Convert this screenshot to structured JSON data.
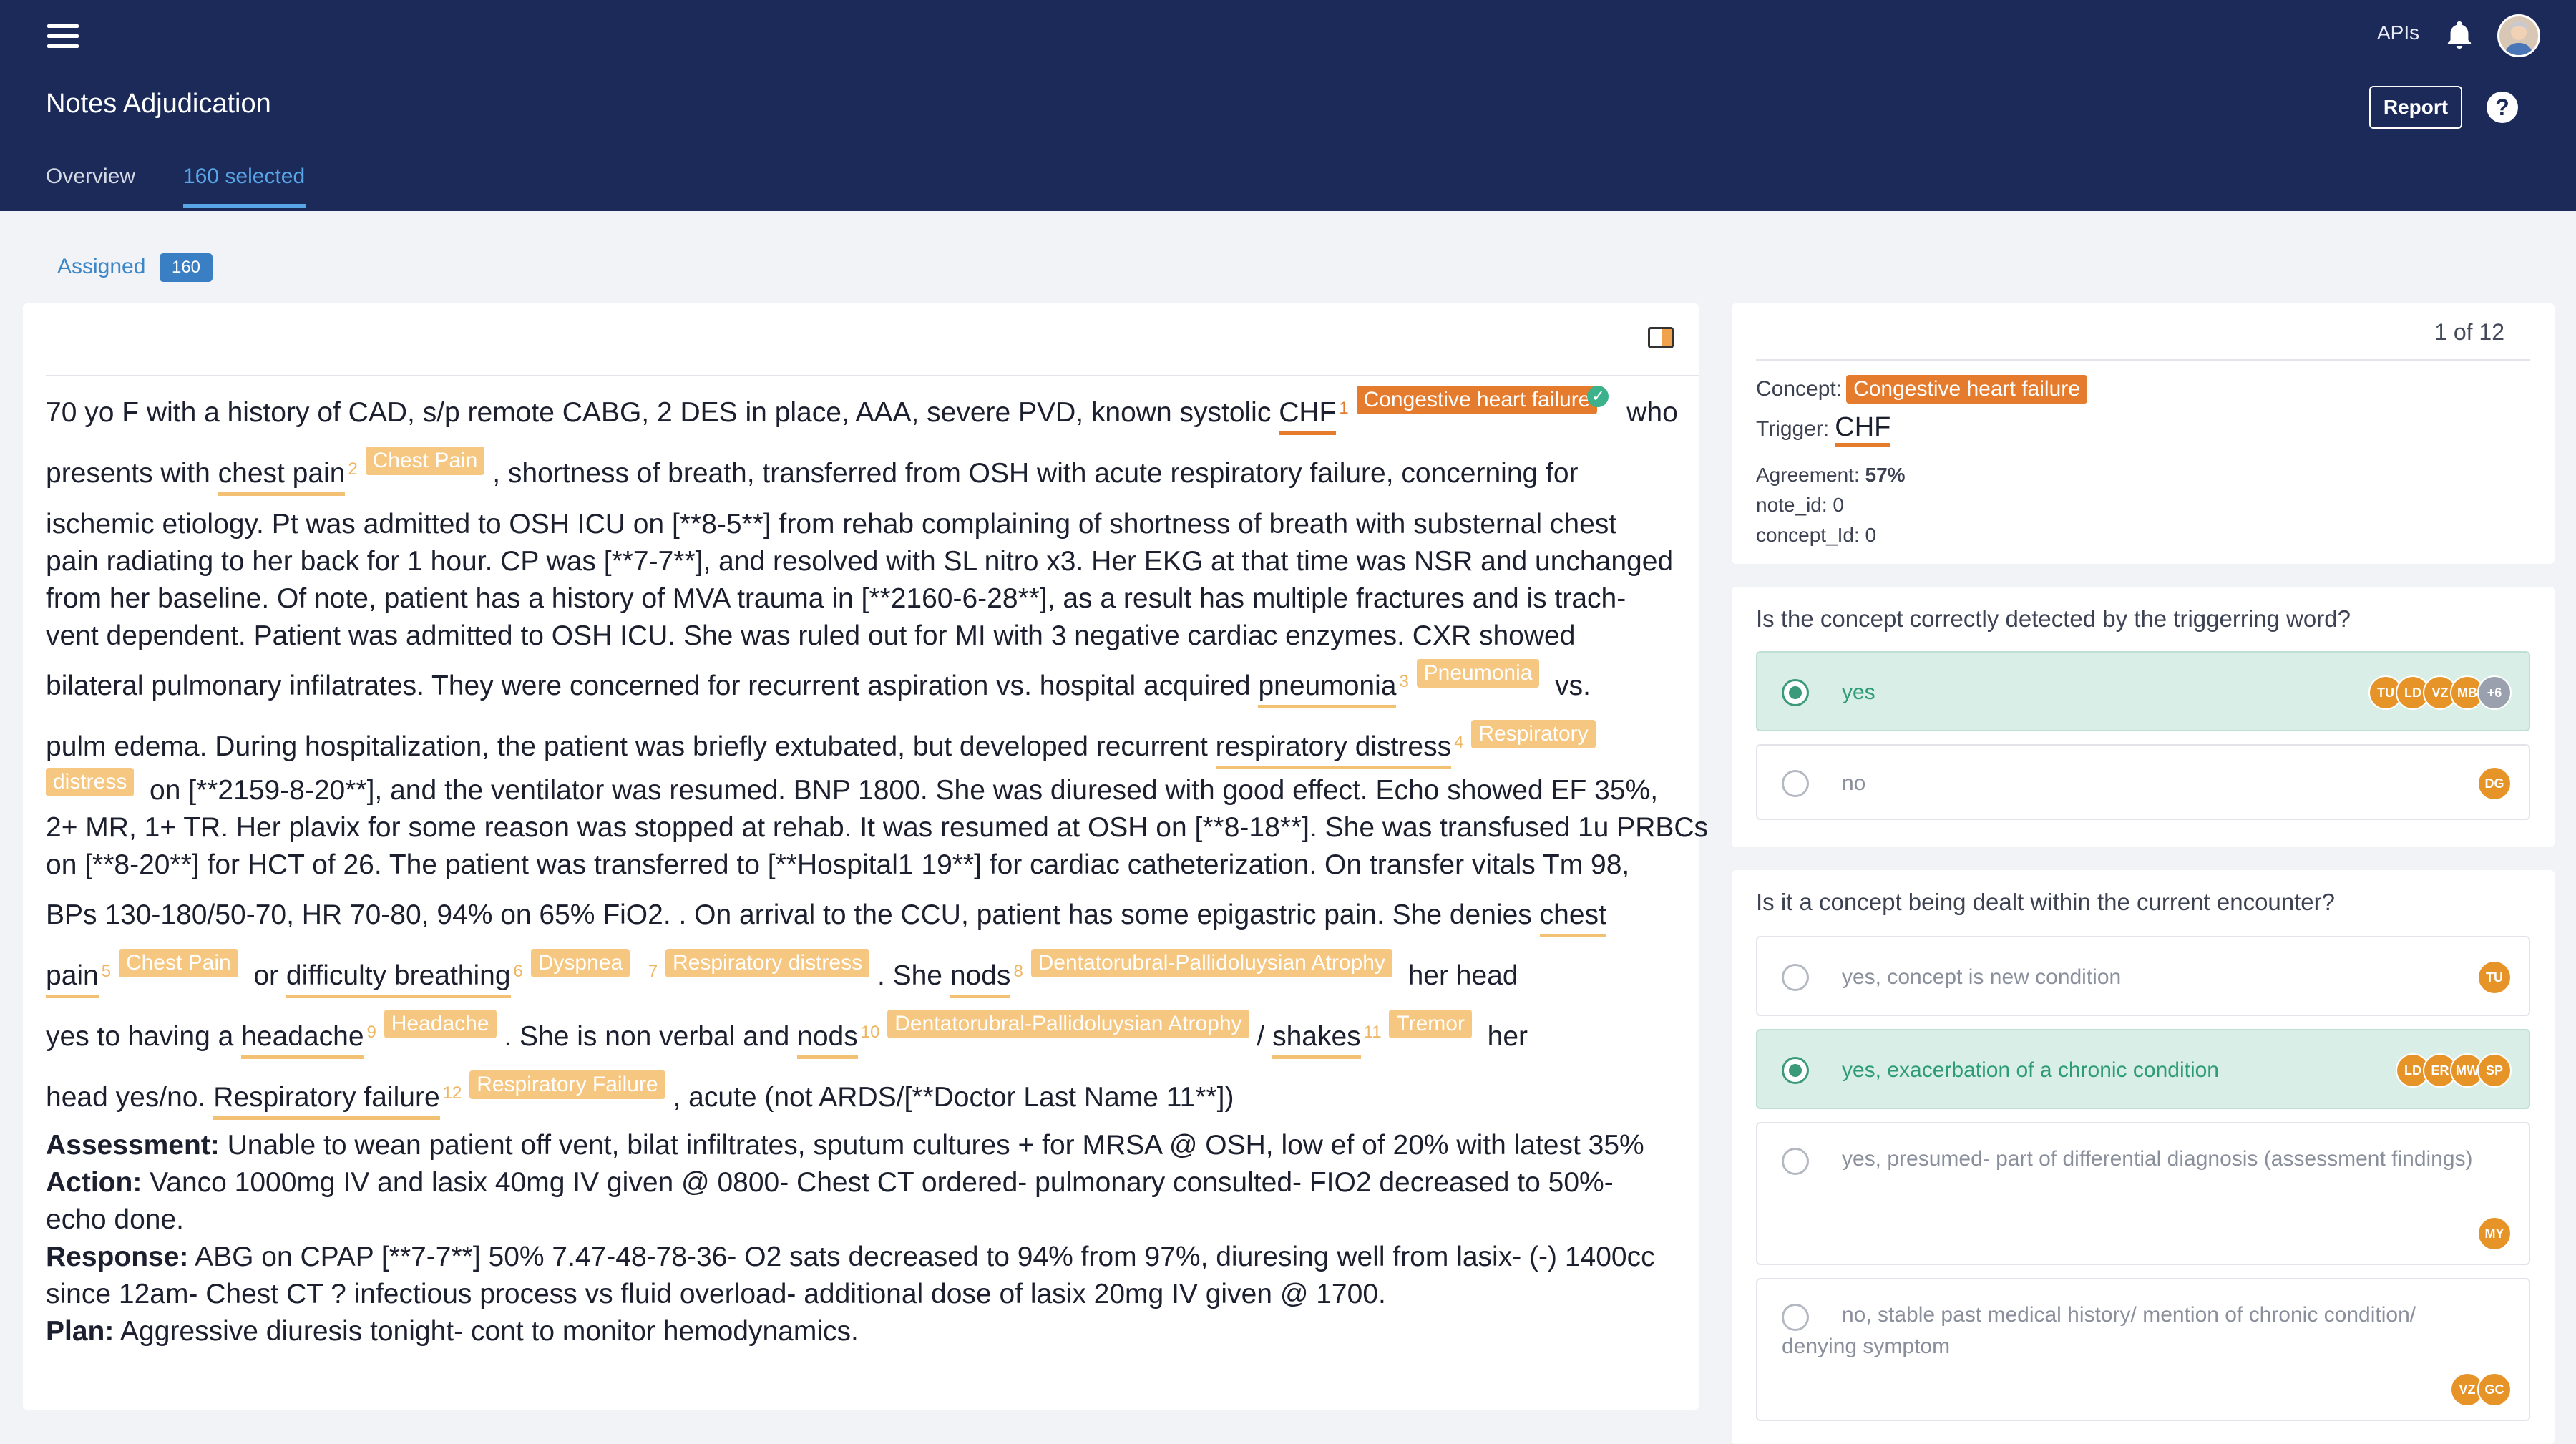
{
  "header": {
    "apis_label": "APIs",
    "title": "Notes Adjudication",
    "report_label": "Report",
    "help_label": "?",
    "tabs": [
      {
        "label": "Overview"
      },
      {
        "label": "160 selected"
      }
    ]
  },
  "assigned": {
    "label": "Assigned",
    "count": "160"
  },
  "note": {
    "p1a": "70 yo F with a history of CAD, s/p remote CABG, 2 DES in place, AAA, severe PVD, known systolic",
    "m1": "CHF",
    "m1_idx": "1",
    "m1_tag": "Congestive heart failure",
    "m1_after": "who",
    "p2a": "presents with",
    "m2": "chest pain",
    "m2_idx": "2",
    "m2_tag": "Chest Pain",
    "p2b": ", shortness of breath, transferred from OSH with acute respiratory failure, concerning for",
    "p3": "ischemic etiology. Pt was admitted to OSH ICU on [**8-5**] from rehab complaining of shortness of breath with substernal chest",
    "p4": "pain radiating to her back for 1 hour. CP was [**7-7**], and resolved with SL nitro x3. Her EKG at that time was NSR and unchanged",
    "p5": "from her baseline. Of note, patient has a history of MVA trauma in [**2160-6-28**], as a result has multiple fractures and is trach-",
    "p6": "vent dependent. Patient was admitted to OSH ICU. She was ruled out for MI with 3 negative cardiac enzymes. CXR showed",
    "p7a": "bilateral pulmonary infilatrates. They were concerned for recurrent aspiration vs. hospital acquired",
    "m3": "pneumonia",
    "m3_idx": "3",
    "m3_tag": "Pneumonia",
    "p7b": "vs.",
    "p8a": "pulm edema. During hospitalization, the patient was briefly extubated, but developed recurrent",
    "m4": "respiratory distress",
    "m4_idx": "4",
    "m4_tag_a": "Respiratory",
    "m4_tag_b": "distress",
    "p9b": "on [**2159-8-20**], and the ventilator was resumed. BNP 1800. She was diuresed with good effect. Echo showed EF 35%,",
    "p10": "2+ MR, 1+ TR. Her plavix for some reason was stopped at rehab. It was resumed at OSH on [**8-18**]. She was transfused 1u PRBCs",
    "p11": "on [**8-20**] for HCT of 26. The patient was transferred to [**Hospital1 19**] for cardiac catheterization. On transfer vitals Tm 98,",
    "p12a": "BPs 130-180/50-70, HR 70-80, 94% on 65% FiO2. . On arrival to the CCU, patient has some epigastric pain. She denies",
    "m5a": "chest",
    "m5b": "pain",
    "m5_idx": "5",
    "m5_tag": "Chest Pain",
    "p13a": "or",
    "m6": "difficulty breathing",
    "m6_idx": "6",
    "m6_tag": "Dyspnea",
    "m7_idx": "7",
    "m7_tag": "Respiratory distress",
    "p13b": ". She",
    "m8": "nods",
    "m8_idx": "8",
    "m8_tag": "Dentatorubral-Pallidoluysian Atrophy",
    "p13c": "her head",
    "p14a": "yes to having a",
    "m9": "headache",
    "m9_idx": "9",
    "m9_tag": "Headache",
    "p14b": ". She is non verbal and",
    "m10": "nods",
    "m10_idx": "10",
    "m10_tag": "Dentatorubral-Pallidoluysian Atrophy",
    "p14c": "/",
    "m11": "shakes",
    "m11_idx": "11",
    "m11_tag": "Tremor",
    "p14d": "her",
    "p15a": "head yes/no.",
    "m12": "Respiratory failure",
    "m12_idx": "12",
    "m12_tag": "Respiratory Failure",
    "p15b": ", acute (not ARDS/[**Doctor Last Name 11**])",
    "assessment_label": "Assessment:",
    "assessment": "Unable to wean patient off vent, bilat infiltrates, sputum cultures + for MRSA @ OSH, low ef of 20% with latest 35%",
    "action_label": "Action:",
    "action_a": "Vanco 1000mg IV and lasix 40mg IV given @ 0800- Chest CT ordered- pulmonary consulted- FIO2 decreased to 50%-",
    "action_b": "echo done.",
    "response_label": "Response:",
    "response_a": "ABG on CPAP [**7-7**] 50% 7.47-48-78-36- O2 sats decreased to 94% from 97%, diuresing well from lasix- (-) 1400cc",
    "response_b": "since 12am- Chest CT ? infectious process vs fluid overload- additional dose of lasix 20mg IV given @ 1700.",
    "plan_label": "Plan:",
    "plan": "Aggressive diuresis tonight- cont to monitor hemodynamics."
  },
  "info": {
    "pager": "1 of 12",
    "concept_label": "Concept:",
    "concept": "Congestive heart failure",
    "trigger_label": "Trigger:",
    "trigger": "CHF",
    "agreement_label": "Agreement:",
    "agreement": "57%",
    "note_id": "note_id: 0",
    "concept_id": "concept_Id: 0"
  },
  "q1": {
    "title": "Is the concept correctly detected by the triggerring word?",
    "options": [
      {
        "label": "yes",
        "avatars": [
          "TU",
          "LD",
          "VZ",
          "MB",
          "+6"
        ]
      },
      {
        "label": "no",
        "avatars": [
          "DG"
        ]
      }
    ]
  },
  "q2": {
    "title": "Is it a concept being dealt within the current encounter?",
    "options": [
      {
        "label": "yes, concept is new condition",
        "avatars": [
          "TU"
        ]
      },
      {
        "label": "yes, exacerbation of a chronic condition",
        "avatars": [
          "LD",
          "ER",
          "MW",
          "SP"
        ]
      },
      {
        "label": "yes, presumed- part of differential diagnosis (assessment findings)",
        "avatars": [
          "MY"
        ]
      },
      {
        "label": "no, stable past medical history/ mention of chronic condition/ denying symptom",
        "avatars": [
          "VZ",
          "GC"
        ]
      }
    ]
  },
  "colors": {
    "header_bg": "#1c2a59",
    "accent_orange": "#e57b2d",
    "tag_light": "#f6c781",
    "selected_green": "#d8eee6",
    "link_blue": "#58a6e8"
  }
}
